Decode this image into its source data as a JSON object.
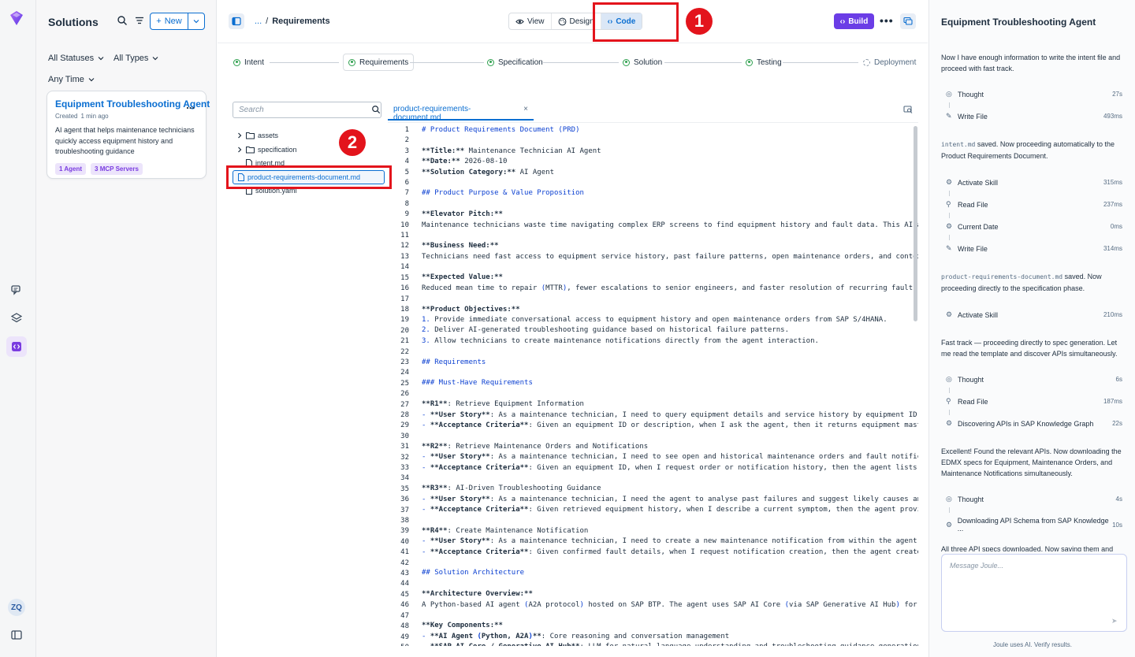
{
  "solutions": {
    "title": "Solutions",
    "new_label": "New",
    "filters": {
      "status": "All Statuses",
      "type": "All Types",
      "time": "Any Time"
    },
    "card": {
      "title": "Equipment Troubleshooting Agent",
      "created_label": "Created",
      "created_time": "1 min ago",
      "description": "AI agent that helps maintenance technicians quickly access equipment history and troubleshooting guidance",
      "tags": [
        "1 Agent",
        "3 MCP Servers"
      ]
    }
  },
  "rail": {
    "avatar": "ZQ"
  },
  "header": {
    "breadcrumb_root": "...",
    "breadcrumb_sep": "/",
    "breadcrumb_current": "Requirements",
    "view_modes": [
      "View",
      "Design",
      "Code"
    ],
    "active_mode": "Code",
    "build_label": "Build"
  },
  "steps": [
    "Intent",
    "Requirements",
    "Specification",
    "Solution",
    "Testing",
    "Deployment"
  ],
  "tree": {
    "search_placeholder": "Search",
    "items": [
      "assets",
      "specification",
      "intent.md",
      "product-requirements-document.md",
      "solution.yaml"
    ]
  },
  "editor": {
    "tab_label": "product-requirements-document.md",
    "tab_close": "×",
    "lines": [
      "# Product Requirements Document (PRD)",
      "",
      "**Title:** Maintenance Technician AI Agent",
      "**Date:** 2026-08-10",
      "**Solution Category:** AI Agent",
      "",
      "## Product Purpose & Value Proposition",
      "",
      "**Elevator Pitch:**",
      "Maintenance technicians waste time navigating complex ERP screens to find equipment history and fault data. This AI ag",
      "",
      "**Business Need:**",
      "Technicians need fast access to equipment service history, past failure patterns, open maintenance orders, and context",
      "",
      "**Expected Value:**",
      "Reduced mean time to repair (MTTR), fewer escalations to senior engineers, and faster resolution of recurring faults t",
      "",
      "**Product Objectives:**",
      "1. Provide immediate conversational access to equipment history and open maintenance orders from SAP S/4HANA.",
      "2. Deliver AI-generated troubleshooting guidance based on historical failure patterns.",
      "3. Allow technicians to create maintenance notifications directly from the agent interaction.",
      "",
      "## Requirements",
      "",
      "### Must-Have Requirements",
      "",
      "**R1**: Retrieve Equipment Information",
      "- **User Story**: As a maintenance technician, I need to query equipment details and service history by equipment ID o",
      "- **Acceptance Criteria**: Given an equipment ID or description, when I ask the agent, then it returns equipment maste",
      "",
      "**R2**: Retrieve Maintenance Orders and Notifications",
      "- **User Story**: As a maintenance technician, I need to see open and historical maintenance orders and fault notifica",
      "- **Acceptance Criteria**: Given an equipment ID, when I request order or notification history, then the agent lists m",
      "",
      "**R3**: AI-Driven Troubleshooting Guidance",
      "- **User Story**: As a maintenance technician, I need the agent to analyse past failures and suggest likely causes and",
      "- **Acceptance Criteria**: Given retrieved equipment history, when I describe a current symptom, then the agent provid",
      "",
      "**R4**: Create Maintenance Notification",
      "- **User Story**: As a maintenance technician, I need to create a new maintenance notification from within the agent c",
      "- **Acceptance Criteria**: Given confirmed fault details, when I request notification creation, then the agent creates",
      "",
      "## Solution Architecture",
      "",
      "**Architecture Overview:**",
      "A Python-based AI agent (A2A protocol) hosted on SAP BTP. The agent uses SAP AI Core (via SAP Generative AI Hub) for L",
      "",
      "**Key Components:**",
      "- **AI Agent (Python, A2A)**: Core reasoning and conversation management",
      "- **SAP AI Core / Generative AI Hub**: LLM for natural language understanding and troubleshooting guidance generation"
    ]
  },
  "chat": {
    "title": "Equipment Troubleshooting Agent",
    "messages": [
      "Now I have enough information to write the intent file and proceed with fast track.",
      "saved. Now proceeding automatically to the Product Requirements Document.",
      "saved. Now proceeding directly to the specification phase.",
      "Fast track — proceeding directly to spec generation. Let me read the template and discover APIs simultaneously.",
      "Excellent! Found the relevant APIs. Now downloading the EDMX specs for Equipment, Maintenance Orders, and Maintenance Notifications simultaneously.",
      "All three API specs downloaded. Now saving them and"
    ],
    "code_refs": [
      "intent.md",
      "product-requirements-document.md"
    ],
    "tools": [
      {
        "label": "Thought",
        "time": "27s"
      },
      {
        "label": "Write File",
        "time": "493ms"
      },
      {
        "label": "Activate Skill",
        "time": "315ms"
      },
      {
        "label": "Read File",
        "time": "237ms"
      },
      {
        "label": "Current Date",
        "time": "0ms"
      },
      {
        "label": "Write File",
        "time": "314ms"
      },
      {
        "label": "Activate Skill",
        "time": "210ms"
      },
      {
        "label": "Thought",
        "time": "6s"
      },
      {
        "label": "Read File",
        "time": "187ms"
      },
      {
        "label": "Discovering APIs in SAP Knowledge Graph",
        "time": "22s"
      },
      {
        "label": "Thought",
        "time": "4s"
      },
      {
        "label": "Downloading API Schema from SAP Knowledge ...",
        "time": "10s"
      }
    ],
    "input_placeholder": "Message Joule...",
    "footer": "Joule uses AI. Verify results."
  },
  "annotations": [
    "1",
    "2"
  ],
  "colors": {
    "accent": "#0a6ed1",
    "build": "#6b3de6",
    "annotation": "#e3141c",
    "step_done": "#2ea04e"
  }
}
